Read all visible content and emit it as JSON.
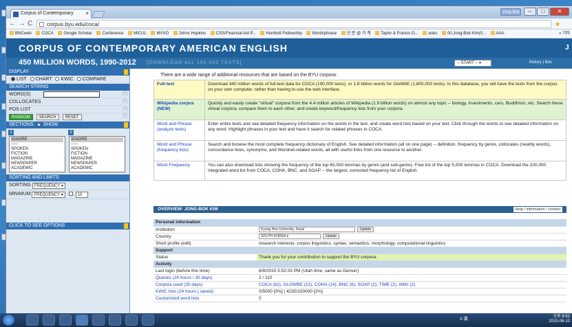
{
  "browser": {
    "tab_title": "Corpus of Contemporary",
    "tab_close": "×",
    "user_badge": "Jong-Bok",
    "url": "corpus.byu.edu/coca/",
    "bookmarks": [
      "BNCweb",
      "COCA",
      "Google Scholar",
      "Conference",
      "MICUL",
      "MVVO",
      "Johns Hopkins",
      "CSS/Financial Aid P...",
      "Humbolt Fellowship",
      "Wordsphrase",
      "신 문 @ 가 계",
      "Taylor & Francis O...",
      "aries",
      "00.Jong-Bok Kim(0...",
      "AAA"
    ],
    "bookmark_more": "» 기타"
  },
  "site": {
    "title": "CORPUS OF CONTEMPORARY AMERICAN ENGLISH",
    "corner": "J",
    "subtitle": "450 MILLION WORDS, 1990-2012",
    "download_link": "[DOWNLOAD ALL 190,000 TEXTS]",
    "start_select": "-- START --",
    "history": "history | lists"
  },
  "sidebar": {
    "display_header": "DISPLAY",
    "display_options": [
      "LIST",
      "CHART",
      "KWIC",
      "COMPARE"
    ],
    "search_header": "SEARCH STRING",
    "words_label": "WORD(S)",
    "collocates_label": "COLLOCATES",
    "pos_label": "POS LIST",
    "random_button": "RANDOM",
    "search_button": "SEARCH",
    "reset_button": "RESET",
    "sections_header": "SECTIONS",
    "show_label": "SHOW",
    "section1_number": "1",
    "section2_number": "2",
    "section_items": [
      "IGNORE",
      "-----",
      "SPOKEN",
      "FICTION",
      "MAGAZINE",
      "NEWSPAPER",
      "ACADEMIC"
    ],
    "sorting_header": "SORTING AND LIMITS",
    "sorting_label": "SORTING",
    "sorting_value": "FREQUENCY",
    "minimum_label": "MINIMUM",
    "minimum_value": "FREQUENCY",
    "minimum_number": "10",
    "options_header": "CLICK TO SEE OPTIONS"
  },
  "main": {
    "intro": "There are a wide range of additional resources that are based on the BYU corpora:",
    "resources": [
      {
        "name": "Full-text",
        "desc": "Download 440 million words of full-text data for COCA (190,000 texts), or 1.8 billion words for GloWbE (1,800,000 texts). In this database, you will have the texts from the corpus on your own computer, rather than having to use the web interface."
      },
      {
        "name": "Wikipedia corpus (NEW)",
        "desc": "Quickly and easily create \"virtual\" corpora from the 4.4 million articles of Wikipedia (1.9 billion words) on almost any topic -- biology, investments, cars, Buddhism, etc. Search these virtual corpora, compare them to each other, and create keyword/frequency lists from your corpora."
      },
      {
        "name": "Word and Phrase (analyze texts)",
        "desc": "Enter entire texts and see detailed frequency information on the words in the text, and create word lists based on your text. Click through the words to see detailed information on any word. Highlight phrases in your text and have it search for related phrases in COCA."
      },
      {
        "name": "Word and Phrase (frequency lists)",
        "desc": "Search and browse the most complete frequency dictionary of English. See detailed information (all on one page) -- definition, frequency by genre, collocates (nearby words), concordance lines, synonyms, and Wordnet-related words, all with useful links from one resource to another."
      },
      {
        "name": "Word Frequency",
        "desc": "You can also download lists showing the frequency of the top 60,000 lemmas by genre (and sub-genre). Free list of the top 5,000 lemmas in COCA. Download the 100,000 integrated word list from COCA, COHA, BNC, and SOAP -- the largest, corrected frequency list of English."
      }
    ],
    "overview_title": "OVERVIEW: JONG-BOK KIM",
    "help_link": "Help / information / contact",
    "personal_header": "Personal information",
    "institution_label": "Institution",
    "institution_value": "Kyung Hee University, Seoul",
    "country_label": "Country",
    "country_value": "SOUTH KOREA",
    "update_button": "Update",
    "profile_label": "Short profile (edit)",
    "profile_value": "research interests: corpus linguistics, syntax, semantics, morphology, computational linguistics",
    "support_header": "Support",
    "status_label": "Status",
    "status_value": "Thank you for your contribution to support the BYU corpora.",
    "activity_header": "Activity",
    "login_label": "Last login (before this time)",
    "login_value": "6/9/2015 5:52:03 PM (Utah time; same as Denver)",
    "queries_label": "Queries (24 hours / 30 days)",
    "queries_value": "2 / 110",
    "corpora_label": "Corpora used (30 days)",
    "corpora_value": "COCA (62), GLOWBE (22), COHA (14), BNC (6), SOAP (2), TIME (2), WIKI (2)",
    "kwic_label": "KWIC lists (24 hours | saved)",
    "kwic_value": "0/5000 [0%] | 4230/150000 [2%]",
    "custom_label": "Customized word lists",
    "custom_value": "0"
  },
  "taskbar": {
    "tray": "A 漢",
    "time": "오후 8:52",
    "date": "2015-06-10"
  }
}
